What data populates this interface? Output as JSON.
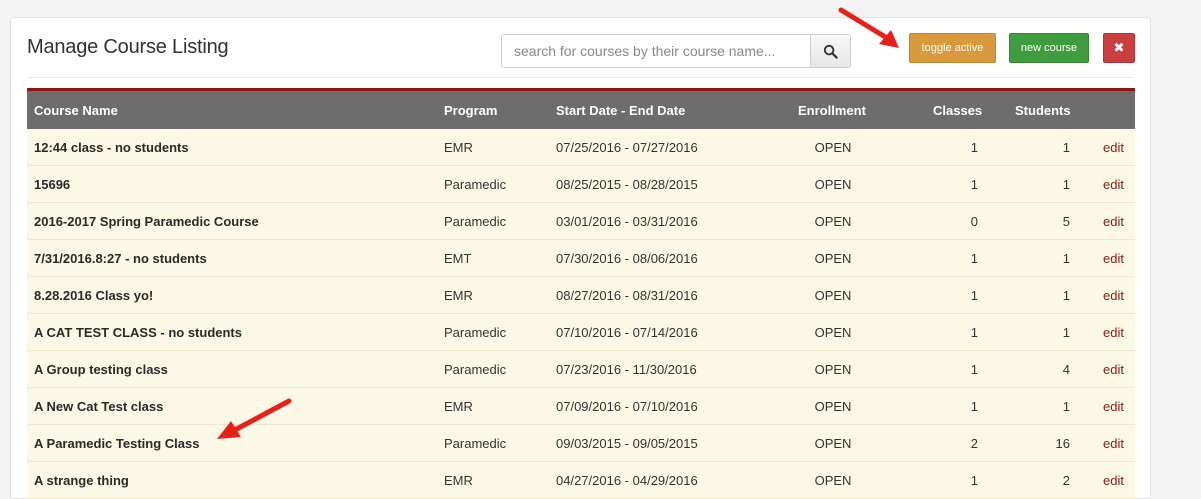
{
  "page": {
    "title": "Manage Course Listing"
  },
  "search": {
    "placeholder": "search for courses by their course name...",
    "value": "",
    "icon": "search-icon"
  },
  "toolbar": {
    "toggle_label": "toggle active",
    "new_label": "new course",
    "close_label": "✖",
    "colors": {
      "toggle": "#d99a3e",
      "new": "#3f9d3f",
      "close": "#c94040"
    }
  },
  "table": {
    "headers": {
      "name": "Course Name",
      "program": "Program",
      "dates": "Start Date - End Date",
      "enrollment": "Enrollment",
      "classes": "Classes",
      "students": "Students"
    },
    "rows": [
      {
        "name": "12:44 class - no students",
        "program": "EMR",
        "dates": "07/25/2016 - 07/27/2016",
        "enrollment": "OPEN",
        "classes": "1",
        "students": "1",
        "action": "edit"
      },
      {
        "name": "15696",
        "program": "Paramedic",
        "dates": "08/25/2015 - 08/28/2015",
        "enrollment": "OPEN",
        "classes": "1",
        "students": "1",
        "action": "edit"
      },
      {
        "name": "2016-2017 Spring Paramedic Course",
        "program": "Paramedic",
        "dates": "03/01/2016 - 03/31/2016",
        "enrollment": "OPEN",
        "classes": "0",
        "students": "5",
        "action": "edit"
      },
      {
        "name": "7/31/2016.8:27 - no students",
        "program": "EMT",
        "dates": "07/30/2016 - 08/06/2016",
        "enrollment": "OPEN",
        "classes": "1",
        "students": "1",
        "action": "edit"
      },
      {
        "name": "8.28.2016 Class yo!",
        "program": "EMR",
        "dates": "08/27/2016 - 08/31/2016",
        "enrollment": "OPEN",
        "classes": "1",
        "students": "1",
        "action": "edit"
      },
      {
        "name": "A CAT TEST CLASS - no students",
        "program": "Paramedic",
        "dates": "07/10/2016 - 07/14/2016",
        "enrollment": "OPEN",
        "classes": "1",
        "students": "1",
        "action": "edit"
      },
      {
        "name": "A Group testing class",
        "program": "Paramedic",
        "dates": "07/23/2016 - 11/30/2016",
        "enrollment": "OPEN",
        "classes": "1",
        "students": "4",
        "action": "edit"
      },
      {
        "name": "A New Cat Test class",
        "program": "EMR",
        "dates": "07/09/2016 - 07/10/2016",
        "enrollment": "OPEN",
        "classes": "1",
        "students": "1",
        "action": "edit"
      },
      {
        "name": "A Paramedic Testing Class",
        "program": "Paramedic",
        "dates": "09/03/2015 - 09/05/2015",
        "enrollment": "OPEN",
        "classes": "2",
        "students": "16",
        "action": "edit"
      },
      {
        "name": "A strange thing",
        "program": "EMR",
        "dates": "04/27/2016 - 04/29/2016",
        "enrollment": "OPEN",
        "classes": "1",
        "students": "2",
        "action": "edit"
      }
    ]
  },
  "annotations": {
    "arrow_color": "#e8201a"
  }
}
